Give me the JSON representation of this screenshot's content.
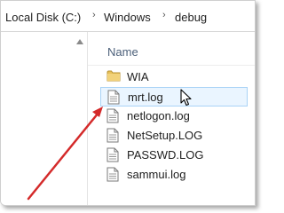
{
  "address_bar": {
    "crumbs": [
      "Local Disk (C:)",
      "Windows",
      "debug"
    ],
    "separator": "›"
  },
  "file_list": {
    "column_header": "Name",
    "items": [
      {
        "name": "WIA",
        "type": "folder",
        "icon": "folder-icon"
      },
      {
        "name": "mrt.log",
        "type": "file",
        "icon": "text-file-icon",
        "selected": true
      },
      {
        "name": "netlogon.log",
        "type": "file",
        "icon": "text-file-icon"
      },
      {
        "name": "NetSetup.LOG",
        "type": "file",
        "icon": "text-file-icon"
      },
      {
        "name": "PASSWD.LOG",
        "type": "file",
        "icon": "text-file-icon"
      },
      {
        "name": "sammui.log",
        "type": "file",
        "icon": "text-file-icon"
      }
    ]
  },
  "colors": {
    "selection_fill": "#eaf5ff",
    "selection_border": "#a9d3f6",
    "annotation_arrow": "#d42a2a",
    "folder": "#e8c15a"
  }
}
